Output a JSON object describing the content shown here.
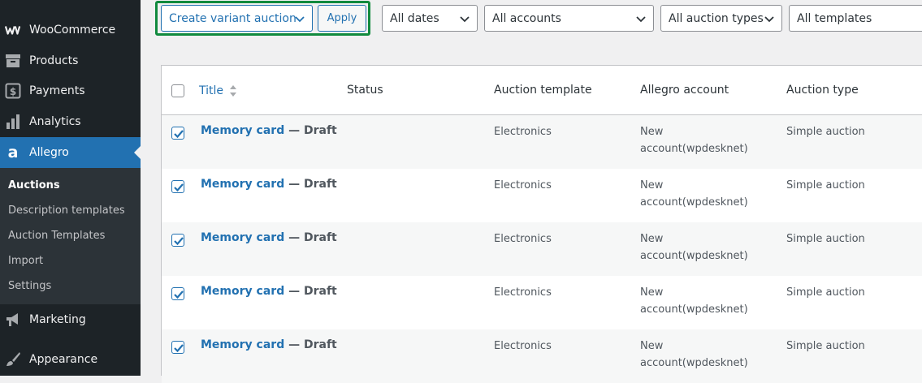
{
  "sidebar": {
    "items": [
      {
        "label": "WooCommerce",
        "icon": "woocommerce-icon"
      },
      {
        "label": "Products",
        "icon": "archive-box-icon"
      },
      {
        "label": "Payments",
        "icon": "dollar-sign-icon"
      },
      {
        "label": "Analytics",
        "icon": "bar-chart-icon"
      },
      {
        "label": "Allegro",
        "icon": "allegro-logo-icon",
        "active": true
      },
      {
        "label": "Marketing",
        "icon": "megaphone-icon"
      },
      {
        "label": "Appearance",
        "icon": "paintbrush-icon"
      }
    ],
    "submenu": [
      {
        "label": "Auctions",
        "current": true
      },
      {
        "label": "Description templates"
      },
      {
        "label": "Auction Templates"
      },
      {
        "label": "Import"
      },
      {
        "label": "Settings"
      }
    ]
  },
  "toolbar": {
    "bulk_action": "Create variant auction",
    "apply_label": "Apply",
    "dates_filter": "All dates",
    "accounts_filter": "All accounts",
    "types_filter": "All auction types",
    "templates_filter": "All templates"
  },
  "table": {
    "columns": {
      "title": "Title",
      "status": "Status",
      "template": "Auction template",
      "account": "Allegro account",
      "type": "Auction type"
    },
    "rows": [
      {
        "title": "Memory card",
        "state": " — Draft",
        "template": "Electronics",
        "account_line1": "New",
        "account_line2": "account(wpdesknet)",
        "type": "Simple auction",
        "checked": true
      },
      {
        "title": "Memory card",
        "state": " — Draft",
        "template": "Electronics",
        "account_line1": "New",
        "account_line2": "account(wpdesknet)",
        "type": "Simple auction",
        "checked": true
      },
      {
        "title": "Memory card",
        "state": " — Draft",
        "template": "Electronics",
        "account_line1": "New",
        "account_line2": "account(wpdesknet)",
        "type": "Simple auction",
        "checked": true
      },
      {
        "title": "Memory card",
        "state": " — Draft",
        "template": "Electronics",
        "account_line1": "New",
        "account_line2": "account(wpdesknet)",
        "type": "Simple auction",
        "checked": true
      },
      {
        "title": "Memory card",
        "state": " — Draft",
        "template": "Electronics",
        "account_line1": "New",
        "account_line2": "account(wpdesknet)",
        "type": "Simple auction",
        "checked": true
      }
    ]
  },
  "colors": {
    "sidebar_bg": "#1d2327",
    "active_menu": "#2271b1",
    "link": "#2271b1",
    "highlight_border": "#118a3e"
  }
}
